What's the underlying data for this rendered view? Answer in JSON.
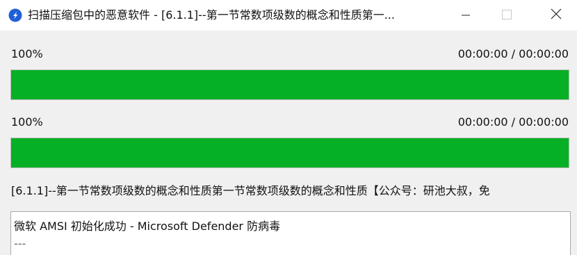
{
  "window": {
    "title": "扫描压缩包中的恶意软件 - [6.1.1]--第一节常数项级数的概念和性质第一...",
    "app_icon": "blue-circle-arrow-icon"
  },
  "controls": {
    "minimize_icon": "minimize-icon",
    "maximize_icon": "maximize-icon",
    "close_icon": "close-icon"
  },
  "progress": [
    {
      "percent_label": "100%",
      "time": "00:00:00 / 00:00:00",
      "value": 1.0
    },
    {
      "percent_label": "100%",
      "time": "00:00:00 / 00:00:00",
      "value": 1.0
    }
  ],
  "current_file": "[6.1.1]--第一节常数项级数的概念和性质第一节常数项级数的概念和性质【公众号：研池大叔，免",
  "log": {
    "lines": [
      "微软 AMSI 初始化成功 - Microsoft Defender 防病毒",
      "---"
    ]
  },
  "colors": {
    "progress_fill": "#06b025",
    "titlebar_bg": "#ffffff",
    "window_bg": "#f0f0f0"
  }
}
